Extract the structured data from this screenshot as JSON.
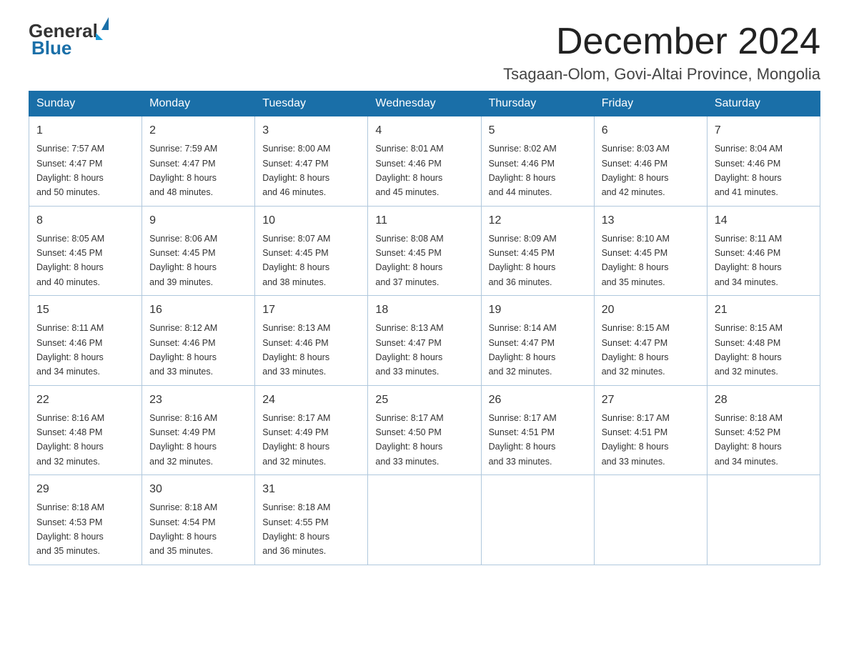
{
  "header": {
    "logo_general": "General",
    "logo_blue": "Blue",
    "title": "December 2024",
    "location": "Tsagaan-Olom, Govi-Altai Province, Mongolia"
  },
  "days_of_week": [
    "Sunday",
    "Monday",
    "Tuesday",
    "Wednesday",
    "Thursday",
    "Friday",
    "Saturday"
  ],
  "weeks": [
    {
      "days": [
        {
          "num": "1",
          "sunrise": "7:57 AM",
          "sunset": "4:47 PM",
          "daylight": "8 hours and 50 minutes."
        },
        {
          "num": "2",
          "sunrise": "7:59 AM",
          "sunset": "4:47 PM",
          "daylight": "8 hours and 48 minutes."
        },
        {
          "num": "3",
          "sunrise": "8:00 AM",
          "sunset": "4:47 PM",
          "daylight": "8 hours and 46 minutes."
        },
        {
          "num": "4",
          "sunrise": "8:01 AM",
          "sunset": "4:46 PM",
          "daylight": "8 hours and 45 minutes."
        },
        {
          "num": "5",
          "sunrise": "8:02 AM",
          "sunset": "4:46 PM",
          "daylight": "8 hours and 44 minutes."
        },
        {
          "num": "6",
          "sunrise": "8:03 AM",
          "sunset": "4:46 PM",
          "daylight": "8 hours and 42 minutes."
        },
        {
          "num": "7",
          "sunrise": "8:04 AM",
          "sunset": "4:46 PM",
          "daylight": "8 hours and 41 minutes."
        }
      ]
    },
    {
      "days": [
        {
          "num": "8",
          "sunrise": "8:05 AM",
          "sunset": "4:45 PM",
          "daylight": "8 hours and 40 minutes."
        },
        {
          "num": "9",
          "sunrise": "8:06 AM",
          "sunset": "4:45 PM",
          "daylight": "8 hours and 39 minutes."
        },
        {
          "num": "10",
          "sunrise": "8:07 AM",
          "sunset": "4:45 PM",
          "daylight": "8 hours and 38 minutes."
        },
        {
          "num": "11",
          "sunrise": "8:08 AM",
          "sunset": "4:45 PM",
          "daylight": "8 hours and 37 minutes."
        },
        {
          "num": "12",
          "sunrise": "8:09 AM",
          "sunset": "4:45 PM",
          "daylight": "8 hours and 36 minutes."
        },
        {
          "num": "13",
          "sunrise": "8:10 AM",
          "sunset": "4:45 PM",
          "daylight": "8 hours and 35 minutes."
        },
        {
          "num": "14",
          "sunrise": "8:11 AM",
          "sunset": "4:46 PM",
          "daylight": "8 hours and 34 minutes."
        }
      ]
    },
    {
      "days": [
        {
          "num": "15",
          "sunrise": "8:11 AM",
          "sunset": "4:46 PM",
          "daylight": "8 hours and 34 minutes."
        },
        {
          "num": "16",
          "sunrise": "8:12 AM",
          "sunset": "4:46 PM",
          "daylight": "8 hours and 33 minutes."
        },
        {
          "num": "17",
          "sunrise": "8:13 AM",
          "sunset": "4:46 PM",
          "daylight": "8 hours and 33 minutes."
        },
        {
          "num": "18",
          "sunrise": "8:13 AM",
          "sunset": "4:47 PM",
          "daylight": "8 hours and 33 minutes."
        },
        {
          "num": "19",
          "sunrise": "8:14 AM",
          "sunset": "4:47 PM",
          "daylight": "8 hours and 32 minutes."
        },
        {
          "num": "20",
          "sunrise": "8:15 AM",
          "sunset": "4:47 PM",
          "daylight": "8 hours and 32 minutes."
        },
        {
          "num": "21",
          "sunrise": "8:15 AM",
          "sunset": "4:48 PM",
          "daylight": "8 hours and 32 minutes."
        }
      ]
    },
    {
      "days": [
        {
          "num": "22",
          "sunrise": "8:16 AM",
          "sunset": "4:48 PM",
          "daylight": "8 hours and 32 minutes."
        },
        {
          "num": "23",
          "sunrise": "8:16 AM",
          "sunset": "4:49 PM",
          "daylight": "8 hours and 32 minutes."
        },
        {
          "num": "24",
          "sunrise": "8:17 AM",
          "sunset": "4:49 PM",
          "daylight": "8 hours and 32 minutes."
        },
        {
          "num": "25",
          "sunrise": "8:17 AM",
          "sunset": "4:50 PM",
          "daylight": "8 hours and 33 minutes."
        },
        {
          "num": "26",
          "sunrise": "8:17 AM",
          "sunset": "4:51 PM",
          "daylight": "8 hours and 33 minutes."
        },
        {
          "num": "27",
          "sunrise": "8:17 AM",
          "sunset": "4:51 PM",
          "daylight": "8 hours and 33 minutes."
        },
        {
          "num": "28",
          "sunrise": "8:18 AM",
          "sunset": "4:52 PM",
          "daylight": "8 hours and 34 minutes."
        }
      ]
    },
    {
      "days": [
        {
          "num": "29",
          "sunrise": "8:18 AM",
          "sunset": "4:53 PM",
          "daylight": "8 hours and 35 minutes."
        },
        {
          "num": "30",
          "sunrise": "8:18 AM",
          "sunset": "4:54 PM",
          "daylight": "8 hours and 35 minutes."
        },
        {
          "num": "31",
          "sunrise": "8:18 AM",
          "sunset": "4:55 PM",
          "daylight": "8 hours and 36 minutes."
        },
        null,
        null,
        null,
        null
      ]
    }
  ],
  "labels": {
    "sunrise": "Sunrise:",
    "sunset": "Sunset:",
    "daylight": "Daylight:"
  }
}
